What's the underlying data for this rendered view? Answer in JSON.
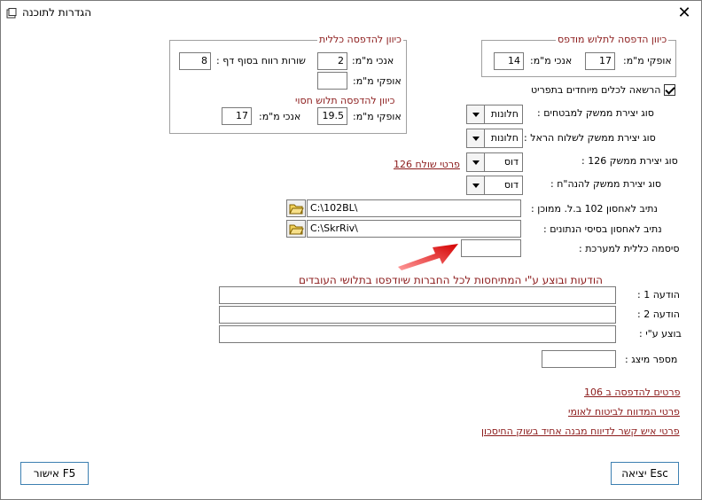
{
  "window": {
    "title": "הגדרות לתוכנה",
    "close": "✕"
  },
  "frame_general": {
    "title": "כיוון להדפסה כללית",
    "vertical_mm_label": "אנכי מ\"מ:",
    "vertical_mm_value": "2",
    "end_rows_label": "שורות רווח בסוף דף :",
    "end_rows_value": "8",
    "horizontal_mm_label": "אופקי מ\"מ:",
    "horizontal_mm_value": "",
    "sub_title": "כיוון להדפסה תלוש חסוי",
    "h2_label": "אופקי מ\"מ:",
    "h2_value": "19.5",
    "v2_label": "אנכי מ\"מ:",
    "v2_value": "17"
  },
  "frame_print": {
    "title": "כיוון הדפסה לתלוש מודפס",
    "horizontal_label": "אופקי מ\"מ:",
    "horizontal_value": "17",
    "vertical_label": "אנכי מ\"מ:",
    "vertical_value": "14"
  },
  "permission": {
    "label": "הרשאה לכלים מיוחדים בתפריט",
    "checked": true
  },
  "rows": [
    {
      "label": "סוג יצירת ממשק למבטחים :",
      "value": "חלונות"
    },
    {
      "label": "סוג יצירת ממשק לשלוח הראל :",
      "value": "חלונות"
    },
    {
      "label": "סוג יצירת ממשק 126 :",
      "value": "דוס"
    },
    {
      "label": "סוג יצירת ממשק להנה\"ח :",
      "value": "דוס"
    }
  ],
  "sender126_link": "פרטי שולח 126",
  "path102": {
    "label": "נתיב לאחסון 102 ב.ל. ממוכן :",
    "value": "C:\\102BL\\"
  },
  "pathdb": {
    "label": "נתיב לאחסון בסיסי הנתונים :",
    "value": "C:\\SkrRiv\\"
  },
  "password": {
    "label": "סיסמה כללית למערכת :",
    "value": ""
  },
  "messages_title": "הודעות ובוצע ע\"י המתיחסות לכל החברות שיודפסו בתלושי העובדים",
  "msg1": {
    "label": "הודעה 1 :",
    "value": ""
  },
  "msg2": {
    "label": "הודעה 2 :",
    "value": ""
  },
  "doneby": {
    "label": "בוצע ע\"י :",
    "value": ""
  },
  "presenter": {
    "label": "מספר מיצג :",
    "value": ""
  },
  "links": {
    "print106": "פרטים להדפסה ב 106",
    "reported_ni": "פרטי המדווח לביטוח לאומי",
    "contact": "פרטי איש קשר לדיווח מבנה אחיד בשוק החיסכון"
  },
  "buttons": {
    "ok": "אישור F5",
    "exit": "יציאה Esc"
  },
  "colors": {
    "accent_text": "#8b1a1a",
    "button_border": "#3c7fb1",
    "arrow": "#e02020"
  }
}
